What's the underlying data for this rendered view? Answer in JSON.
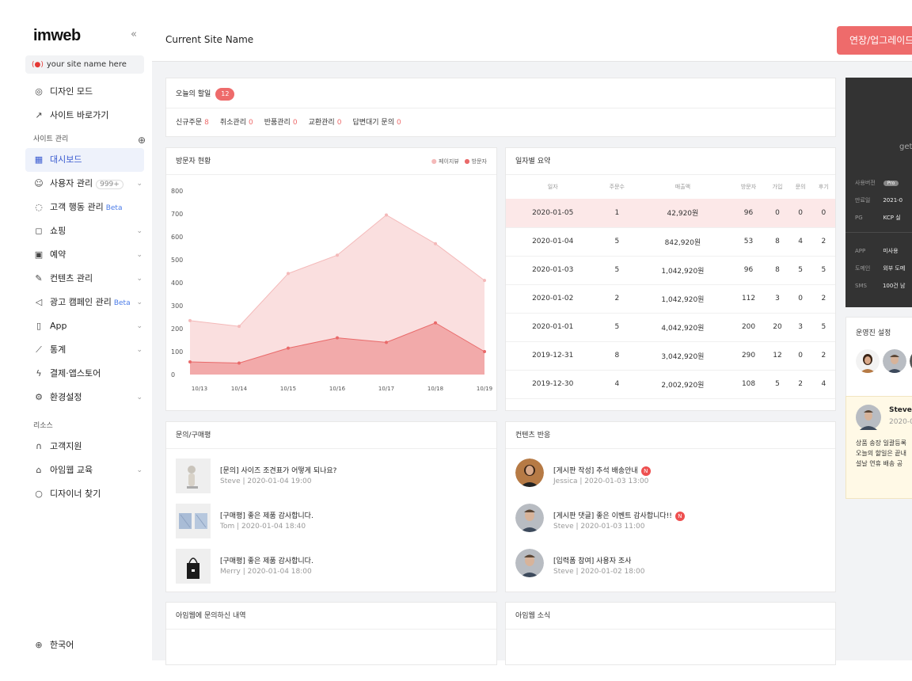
{
  "sidebar": {
    "logo": "imweb",
    "collapse": "«",
    "site_name": "your site name here",
    "top_items": [
      {
        "icon": "palette-icon",
        "glyph": "◎",
        "label": "디자인 모드"
      },
      {
        "icon": "external-link-icon",
        "glyph": "↗",
        "label": "사이트 바로가기"
      }
    ],
    "section_site": "사이트 관리",
    "section_site_add": "⊕",
    "items": [
      {
        "icon": "dashboard-icon",
        "glyph": "▦",
        "label": "대시보드",
        "active": true
      },
      {
        "icon": "users-icon",
        "glyph": "☺",
        "label": "사용자 관리",
        "count": "999+",
        "chevron": true
      },
      {
        "icon": "target-icon",
        "glyph": "◌",
        "label": "고객 행동 관리",
        "beta": "Beta"
      },
      {
        "icon": "bag-icon",
        "glyph": "◻",
        "label": "쇼핑",
        "chevron": true
      },
      {
        "icon": "calendar-icon",
        "glyph": "▣",
        "label": "예약",
        "chevron": true
      },
      {
        "icon": "edit-icon",
        "glyph": "✎",
        "label": "컨텐츠 관리",
        "chevron": true
      },
      {
        "icon": "megaphone-icon",
        "glyph": "◁",
        "label": "광고 캠페인 관리",
        "beta": "Beta",
        "chevron": true
      },
      {
        "icon": "mobile-icon",
        "glyph": "▯",
        "label": "App",
        "chevron": true
      },
      {
        "icon": "chart-icon",
        "glyph": "⟋",
        "label": "통계",
        "chevron": true
      },
      {
        "icon": "bolt-icon",
        "glyph": "ϟ",
        "label": "결제·앱스토어"
      },
      {
        "icon": "gear-icon",
        "glyph": "⚙",
        "label": "환경설정",
        "chevron": true
      }
    ],
    "section_resource": "리소스",
    "resource_items": [
      {
        "icon": "headset-icon",
        "glyph": "∩",
        "label": "고객지원"
      },
      {
        "icon": "graduation-icon",
        "glyph": "⌂",
        "label": "아임웹 교육",
        "chevron": true
      },
      {
        "icon": "search-icon",
        "glyph": "○",
        "label": "디자이너 찾기"
      }
    ],
    "language": {
      "icon": "globe-icon",
      "glyph": "⊕",
      "label": "한국어"
    },
    "chevron_glyph": "⌄"
  },
  "topbar": {
    "site_title": "Current Site Name",
    "upgrade_label": "연장/업그레이드"
  },
  "todo": {
    "title": "오늘의 할일",
    "count": "12",
    "stats": [
      {
        "label": "신규주문",
        "value": "8"
      },
      {
        "label": "취소관리",
        "value": "0"
      },
      {
        "label": "반품관리",
        "value": "0"
      },
      {
        "label": "교환관리",
        "value": "0"
      },
      {
        "label": "답변대기 문의",
        "value": "0"
      }
    ]
  },
  "visitors": {
    "title": "방문자 현황",
    "legend_pageviews": "페이지뷰",
    "legend_visitors": "방문자"
  },
  "chart_data": {
    "type": "area",
    "x": [
      "10/13",
      "10/14",
      "10/15",
      "10/16",
      "10/17",
      "10/18",
      "10/19"
    ],
    "ylim": [
      0,
      800
    ],
    "yticks": [
      0,
      100,
      200,
      300,
      400,
      500,
      600,
      700,
      800
    ],
    "series": [
      {
        "name": "페이지뷰",
        "values": [
          235,
          210,
          440,
          520,
          695,
          570,
          410
        ],
        "color": "#f4b9b9"
      },
      {
        "name": "방문자",
        "values": [
          55,
          50,
          115,
          160,
          140,
          225,
          100
        ],
        "color": "#e96a6a"
      }
    ]
  },
  "daily": {
    "title": "일자별 요약",
    "headers": [
      "일자",
      "주문수",
      "매출액",
      "방문자",
      "가입",
      "문의",
      "후기"
    ],
    "rows": [
      [
        "2020-01-05",
        "1",
        "42,920원",
        "96",
        "0",
        "0",
        "0"
      ],
      [
        "2020-01-04",
        "5",
        "842,920원",
        "53",
        "8",
        "4",
        "2"
      ],
      [
        "2020-01-03",
        "5",
        "1,042,920원",
        "96",
        "8",
        "5",
        "5"
      ],
      [
        "2020-01-02",
        "2",
        "1,042,920원",
        "112",
        "3",
        "0",
        "2"
      ],
      [
        "2020-01-01",
        "5",
        "4,042,920원",
        "200",
        "20",
        "3",
        "5"
      ],
      [
        "2019-12-31",
        "8",
        "3,042,920원",
        "290",
        "12",
        "0",
        "2"
      ],
      [
        "2019-12-30",
        "4",
        "2,002,920원",
        "108",
        "5",
        "2",
        "4"
      ]
    ]
  },
  "inquiries": {
    "title": "문의/구매평",
    "items": [
      {
        "title": "[문의] 사이즈 조견표가 어떻게 되나요?",
        "meta": "Steve  |  2020-01-04 19:00"
      },
      {
        "title": "[구매평] 좋은 제품 감사합니다.",
        "meta": "Tom  |  2020-01-04 18:40"
      },
      {
        "title": "[구매평] 좋은 제품 감사합니다.",
        "meta": "Merry  |  2020-01-04 18:00"
      }
    ]
  },
  "contents": {
    "title": "컨텐츠 반응",
    "items": [
      {
        "title": "[게시판 작성] 추석 배송안내",
        "meta": "Jessica  |  2020-01-03 13:00",
        "badge": "N"
      },
      {
        "title": "[게시판 댓글] 좋은 이벤트 감사합니다!!",
        "meta": "Steve  |  2020-01-03 11:00",
        "badge": "N"
      },
      {
        "title": "[입력폼 참여] 사용자 조사",
        "meta": "Steve  |  2020-01-02 18:00"
      }
    ]
  },
  "history": {
    "title": "아임웹에 문의하신 내역"
  },
  "news": {
    "title": "아임웹 소식"
  },
  "plan": {
    "get_text": "get",
    "version_label": "사용버전",
    "version_value": "Pro",
    "expiry_label": "만료일",
    "expiry_value": "2021-0",
    "pg_label": "PG",
    "pg_value": "KCP 실",
    "app_label": "APP",
    "app_value": "미사용",
    "domain_label": "도메인",
    "domain_value": "외부 도메",
    "sms_label": "SMS",
    "sms_value": "100건 남"
  },
  "operators": {
    "title": "운영진 설정"
  },
  "review": {
    "name": "Steve",
    "date": "2020-0",
    "lines": [
      "상품 송장 일괄등록",
      "오늘의 할일은 끝내",
      "설날 연휴 배송 공"
    ]
  }
}
